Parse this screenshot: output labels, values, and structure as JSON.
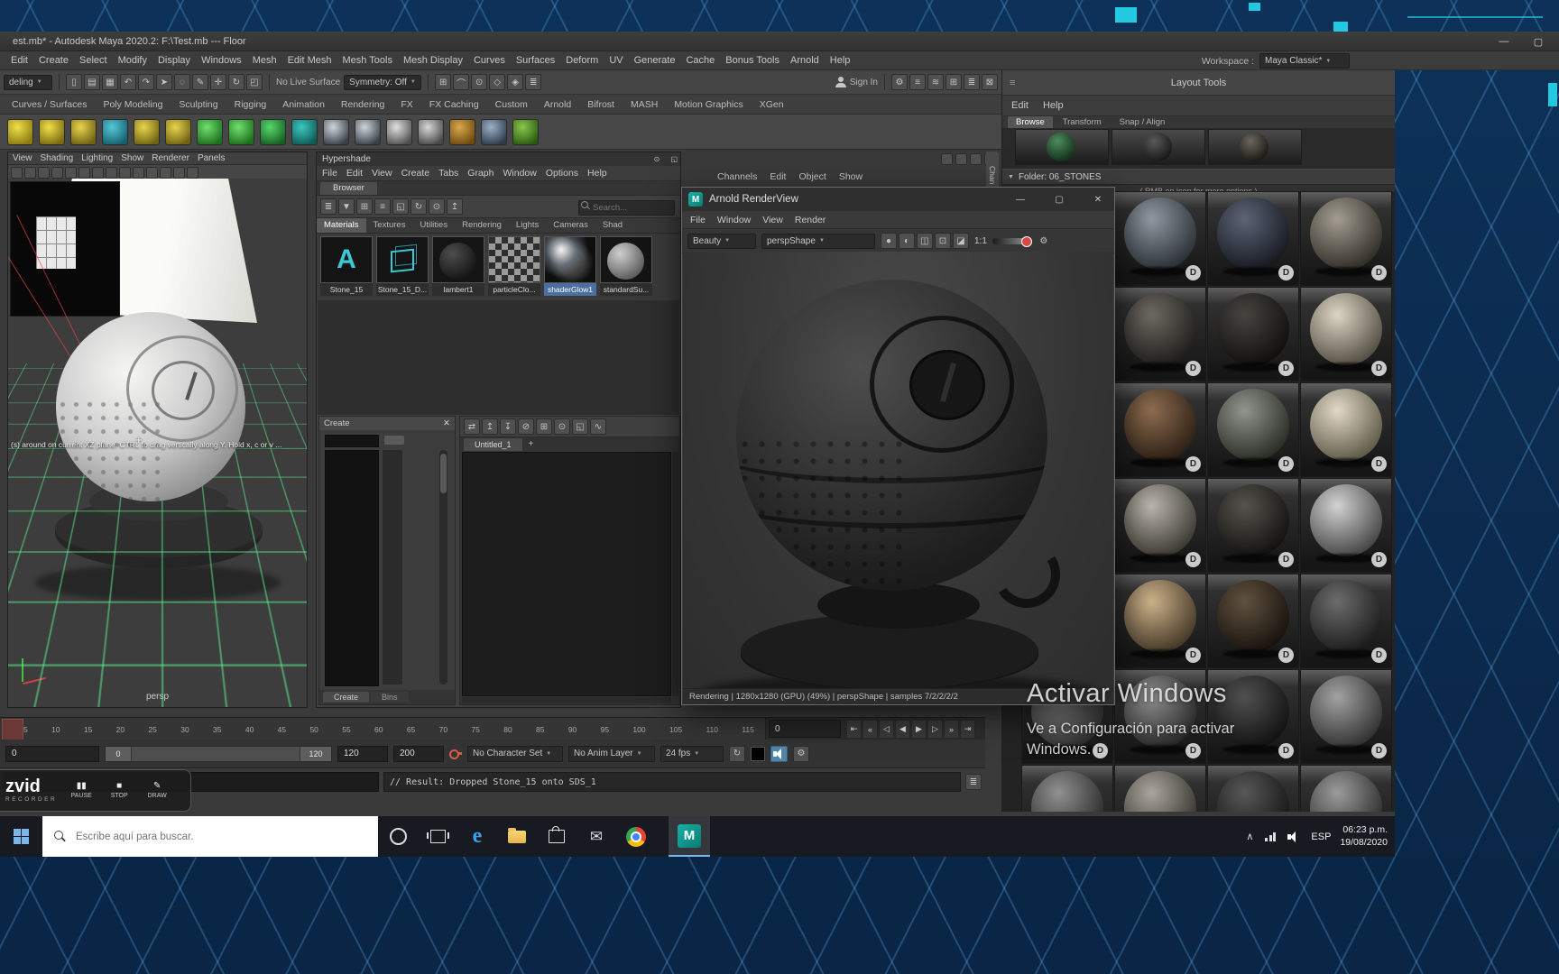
{
  "maya": {
    "title": "est.mb* - Autodesk Maya 2020.2: F:\\Test.mb   ---   Floor",
    "window_minimize": "—",
    "window_restore": "▢",
    "menus": [
      "Edit",
      "Create",
      "Select",
      "Modify",
      "Display",
      "Windows",
      "Mesh",
      "Edit Mesh",
      "Mesh Tools",
      "Mesh Display",
      "Curves",
      "Surfaces",
      "Deform",
      "UV",
      "Generate",
      "Cache",
      "Bonus Tools",
      "Arnold",
      "Help"
    ],
    "workspace_label": "Workspace :",
    "workspace_value": "Maya Classic*",
    "menuset": "deling"
  },
  "toolbar": {
    "left_icons": [
      {
        "name": "new-scene",
        "glyph": "▯"
      },
      {
        "name": "open-scene",
        "glyph": "▤"
      },
      {
        "name": "save-scene",
        "glyph": "▦"
      },
      {
        "name": "undo",
        "glyph": "↶"
      },
      {
        "name": "redo",
        "glyph": "↷"
      },
      {
        "name": "select-tool",
        "glyph": "➤"
      },
      {
        "name": "lasso-tool",
        "glyph": "◌"
      },
      {
        "name": "paint-select-tool",
        "glyph": "✎"
      },
      {
        "name": "move-tool",
        "glyph": "✛"
      },
      {
        "name": "rotate-tool",
        "glyph": "↻"
      },
      {
        "name": "scale-tool",
        "glyph": "◰"
      }
    ],
    "live_surface": "No Live Surface",
    "symmetry": "Symmetry: Off",
    "mid_icons": [
      {
        "name": "snap-to-grid",
        "glyph": "⊞"
      },
      {
        "name": "snap-to-curve",
        "glyph": "⌒"
      },
      {
        "name": "snap-to-point",
        "glyph": "⊙"
      },
      {
        "name": "snap-to-plane",
        "glyph": "◇"
      },
      {
        "name": "make-live",
        "glyph": "◈"
      },
      {
        "name": "construction-history",
        "glyph": "≣"
      }
    ],
    "sign_in": "Sign In",
    "right_icons": [
      {
        "name": "render-settings",
        "glyph": "⚙"
      },
      {
        "name": "display-layer-editor",
        "glyph": "≡"
      },
      {
        "name": "anim-layer-editor",
        "glyph": "≋"
      },
      {
        "name": "grid-toggle",
        "glyph": "⊞"
      },
      {
        "name": "outliner-toggle",
        "glyph": "≣"
      },
      {
        "name": "workspace-stack",
        "glyph": "⊠"
      }
    ]
  },
  "shelf": {
    "tabs": [
      "Curves / Surfaces",
      "Poly Modeling",
      "Sculpting",
      "Rigging",
      "Animation",
      "Rendering",
      "FX",
      "FX Caching",
      "Custom",
      "Arnold",
      "Bifrost",
      "MASH",
      "Motion Graphics",
      "XGen"
    ],
    "icons": [
      {
        "name": "nurbs-circle",
        "c1": "#f0e04a",
        "c2": "#8a7a10"
      },
      {
        "name": "nurbs-sphere",
        "c1": "#f0e04a",
        "c2": "#7a6a10"
      },
      {
        "name": "nurbs-cylinder",
        "c1": "#e8d44d",
        "c2": "#6f6212"
      },
      {
        "name": "earth-globe",
        "c1": "#56c8d8",
        "c2": "#14606e"
      },
      {
        "name": "nurbs-torus",
        "c1": "#e8d44d",
        "c2": "#6f6212"
      },
      {
        "name": "nurbs-cone",
        "c1": "#e8d44d",
        "c2": "#6f6212"
      },
      {
        "name": "poly-cube",
        "c1": "#6fe06f",
        "c2": "#1d6e1d"
      },
      {
        "name": "poly-cube-smooth",
        "c1": "#6fe06f",
        "c2": "#1d6e1d"
      },
      {
        "name": "poly-s-shape",
        "c1": "#56d86a",
        "c2": "#176024"
      },
      {
        "name": "poly-cones",
        "c1": "#3cc8c0",
        "c2": "#0e5a56"
      },
      {
        "name": "uv-checker-a",
        "c1": "#cfd4da",
        "c2": "#3a4048"
      },
      {
        "name": "uv-checker-b",
        "c1": "#cfd4da",
        "c2": "#3a4048"
      },
      {
        "name": "multi-cut",
        "c1": "#e0e0e0",
        "c2": "#505050"
      },
      {
        "name": "target-weld",
        "c1": "#d8d8d8",
        "c2": "#484848"
      },
      {
        "name": "quad-draw",
        "c1": "#d8a84a",
        "c2": "#6e4a10"
      },
      {
        "name": "camera-tool",
        "c1": "#9ab0c8",
        "c2": "#2e3c4c"
      },
      {
        "name": "playblast",
        "c1": "#88c74d",
        "c2": "#2c5a10"
      }
    ]
  },
  "viewport": {
    "menus": [
      "View",
      "Shading",
      "Lighting",
      "Show",
      "Renderer",
      "Panels"
    ],
    "hint": "(s) around on current XZ plane.  CTRL to drag vertically along Y.  Hold x, c or v ...",
    "camera": "persp"
  },
  "hypershade": {
    "title": "Hypershade",
    "menus": [
      "File",
      "Edit",
      "View",
      "Create",
      "Tabs",
      "Graph",
      "Window",
      "Options",
      "Help"
    ],
    "browser_tab": "Browser",
    "toolbar_icons": [
      {
        "name": "sort",
        "glyph": "≣"
      },
      {
        "name": "filter",
        "glyph": "▼"
      },
      {
        "name": "icon-view",
        "glyph": "⊞"
      },
      {
        "name": "list-view",
        "glyph": "≡"
      },
      {
        "name": "swatch-size",
        "glyph": "◱"
      },
      {
        "name": "refresh-swatches",
        "glyph": "↻"
      },
      {
        "name": "pin",
        "glyph": "⊙"
      },
      {
        "name": "parent-dir",
        "glyph": "↥"
      }
    ],
    "search_placeholder": "Search...",
    "category_tabs": [
      {
        "label": "Materials",
        "sel": true
      },
      {
        "label": "Textures"
      },
      {
        "label": "Utilities"
      },
      {
        "label": "Rendering"
      },
      {
        "label": "Lights"
      },
      {
        "label": "Cameras"
      },
      {
        "label": "Shad"
      }
    ],
    "swatches": [
      {
        "name": "Stone_15",
        "kind": "arnold-a"
      },
      {
        "name": "Stone_15_D...",
        "kind": "cube"
      },
      {
        "name": "lambert1",
        "kind": "dark-sphere"
      },
      {
        "name": "particleClo...",
        "kind": "checker"
      },
      {
        "name": "shaderGlow1",
        "kind": "glow",
        "sel": true
      },
      {
        "name": "standardSu...",
        "kind": "gray-sphere"
      }
    ],
    "create_title": "Create",
    "bottom_tabs": [
      "Create",
      "Bins"
    ],
    "work_icons": [
      {
        "name": "input-output-connections",
        "glyph": "⇄"
      },
      {
        "name": "graph-upstream",
        "glyph": "↥"
      },
      {
        "name": "graph-downstream",
        "glyph": "↧"
      },
      {
        "name": "clear-graph",
        "glyph": "⊘"
      },
      {
        "name": "rearrange-graph",
        "glyph": "⊞"
      },
      {
        "name": "pin-nodes",
        "glyph": "⊙"
      },
      {
        "name": "frame-all",
        "glyph": "◱"
      },
      {
        "name": "show-connections",
        "glyph": "∿"
      }
    ],
    "work_tab": "Untitled_1",
    "add_tab": "+"
  },
  "channel_box": {
    "menus": [
      "Channels",
      "Edit",
      "Object",
      "Show"
    ],
    "vertical_tab": "Chan"
  },
  "arnold": {
    "title": "Arnold RenderView",
    "menus": [
      "File",
      "Window",
      "View",
      "Render"
    ],
    "aov": "Beauty",
    "camera": "perspShape",
    "ratio": "1:1",
    "tools": [
      {
        "name": "start-render",
        "glyph": "●"
      },
      {
        "name": "snapshot",
        "glyph": "◐"
      },
      {
        "name": "save-image",
        "glyph": "◫"
      },
      {
        "name": "display-mode",
        "glyph": "⊡"
      },
      {
        "name": "gamma-view",
        "glyph": "◪"
      }
    ],
    "status": "Rendering | 1280x1280 (GPU) (49%) | perspShape | samples 7/2/2/2/2",
    "win_minimize": "—",
    "win_maximize": "▢",
    "win_close": "✕",
    "gear": "⚙"
  },
  "stones_panel": {
    "header": "Layout Tools",
    "menus": [
      "Edit",
      "Help"
    ],
    "tabs": [
      {
        "label": "Browse",
        "sel": true
      },
      {
        "label": "Transform"
      },
      {
        "label": "Snap / Align"
      }
    ],
    "folder": "Folder:  06_STONES",
    "hint": "( RMB on icon for more options )",
    "badge": "D",
    "previews": [
      {
        "c1": "#4e8a5c",
        "c2": "#0f2c18"
      },
      {
        "c1": "#5a5a5a",
        "c2": "#141414"
      },
      {
        "c1": "#6a665e",
        "c2": "#17150f"
      }
    ],
    "stones": [
      {
        "c1": "#808080",
        "c2": "#202020"
      },
      {
        "c1": "#9099a2",
        "c2": "#262a30"
      },
      {
        "c1": "#5c6476",
        "c2": "#13151c"
      },
      {
        "c1": "#a39d92",
        "c2": "#2b2822"
      },
      {
        "c1": "#7d7d7d",
        "c2": "#1f1f1f"
      },
      {
        "c1": "#6e6a63",
        "c2": "#1a1917"
      },
      {
        "c1": "#474440",
        "c2": "#0d0c0b"
      },
      {
        "c1": "#ddd5c4",
        "c2": "#4c463c"
      },
      {
        "c1": "#7a7a7a",
        "c2": "#1e1e1e"
      },
      {
        "c1": "#8f6d50",
        "c2": "#261b11"
      },
      {
        "c1": "#90958d",
        "c2": "#24261f"
      },
      {
        "c1": "#e2d9c6",
        "c2": "#575241"
      },
      {
        "c1": "#787878",
        "c2": "#1d1d1d"
      },
      {
        "c1": "#bab6ae",
        "c2": "#34312b"
      },
      {
        "c1": "#56534d",
        "c2": "#0f0e0c"
      },
      {
        "c1": "#d2d2d2",
        "c2": "#3e3e3e"
      },
      {
        "c1": "#767676",
        "c2": "#1c1c1c"
      },
      {
        "c1": "#ccb28b",
        "c2": "#3c3120"
      },
      {
        "c1": "#60513f",
        "c2": "#130f0a"
      },
      {
        "c1": "#6c6c6c",
        "c2": "#171717"
      },
      {
        "c1": "#9c9c9c",
        "c2": "#272727"
      },
      {
        "c1": "#8e8e8e",
        "c2": "#212121"
      },
      {
        "c1": "#505050",
        "c2": "#0e0e0e"
      },
      {
        "c1": "#a2a2a2",
        "c2": "#2b2b2b"
      },
      {
        "c1": "#919191",
        "c2": "#232323"
      },
      {
        "c1": "#aaa69e",
        "c2": "#2d2b25"
      },
      {
        "c1": "#585858",
        "c2": "#111111"
      },
      {
        "c1": "#9c9c9c",
        "c2": "#252525"
      }
    ]
  },
  "timeline": {
    "frames": [
      "5",
      "10",
      "15",
      "20",
      "25",
      "30",
      "35",
      "40",
      "45",
      "50",
      "55",
      "60",
      "65",
      "70",
      "75",
      "80",
      "85",
      "90",
      "95",
      "100",
      "105",
      "110",
      "115"
    ],
    "current": "0",
    "playback": [
      {
        "name": "go-to-start",
        "glyph": "⇤"
      },
      {
        "name": "step-back-frame",
        "glyph": "«"
      },
      {
        "name": "step-back-key",
        "glyph": "◁"
      },
      {
        "name": "play-backwards",
        "glyph": "◀"
      },
      {
        "name": "play-forwards",
        "glyph": "▶"
      },
      {
        "name": "step-forward-key",
        "glyph": "▷"
      },
      {
        "name": "step-forward-frame",
        "glyph": "»"
      },
      {
        "name": "go-to-end",
        "glyph": "⇥"
      }
    ]
  },
  "range_bar": {
    "start_field": "0",
    "slider_start": "0",
    "slider_end": "120",
    "end_field": "120",
    "anim_end_field": "200",
    "character_set": "No Character Set",
    "anim_layer": "No Anim Layer",
    "fps": "24 fps"
  },
  "command_line": {
    "result": "// Result: Dropped Stone_15 onto SDS_1"
  },
  "recorder": {
    "brand": "zvid",
    "sub": "RECORDER",
    "buttons": [
      {
        "label": "PAUSE",
        "glyph": "▮▮"
      },
      {
        "label": "STOP",
        "glyph": "■"
      },
      {
        "label": "DRAW",
        "glyph": "✎"
      }
    ]
  },
  "taskbar": {
    "search_placeholder": "Escribe aquí para buscar.",
    "lang": "ESP",
    "time": "06:23 p.m.",
    "date": "19/08/2020"
  },
  "watermark": {
    "line1": "Activar Windows",
    "line2": "Ve a Configuración para activar",
    "line3": "Windows."
  }
}
